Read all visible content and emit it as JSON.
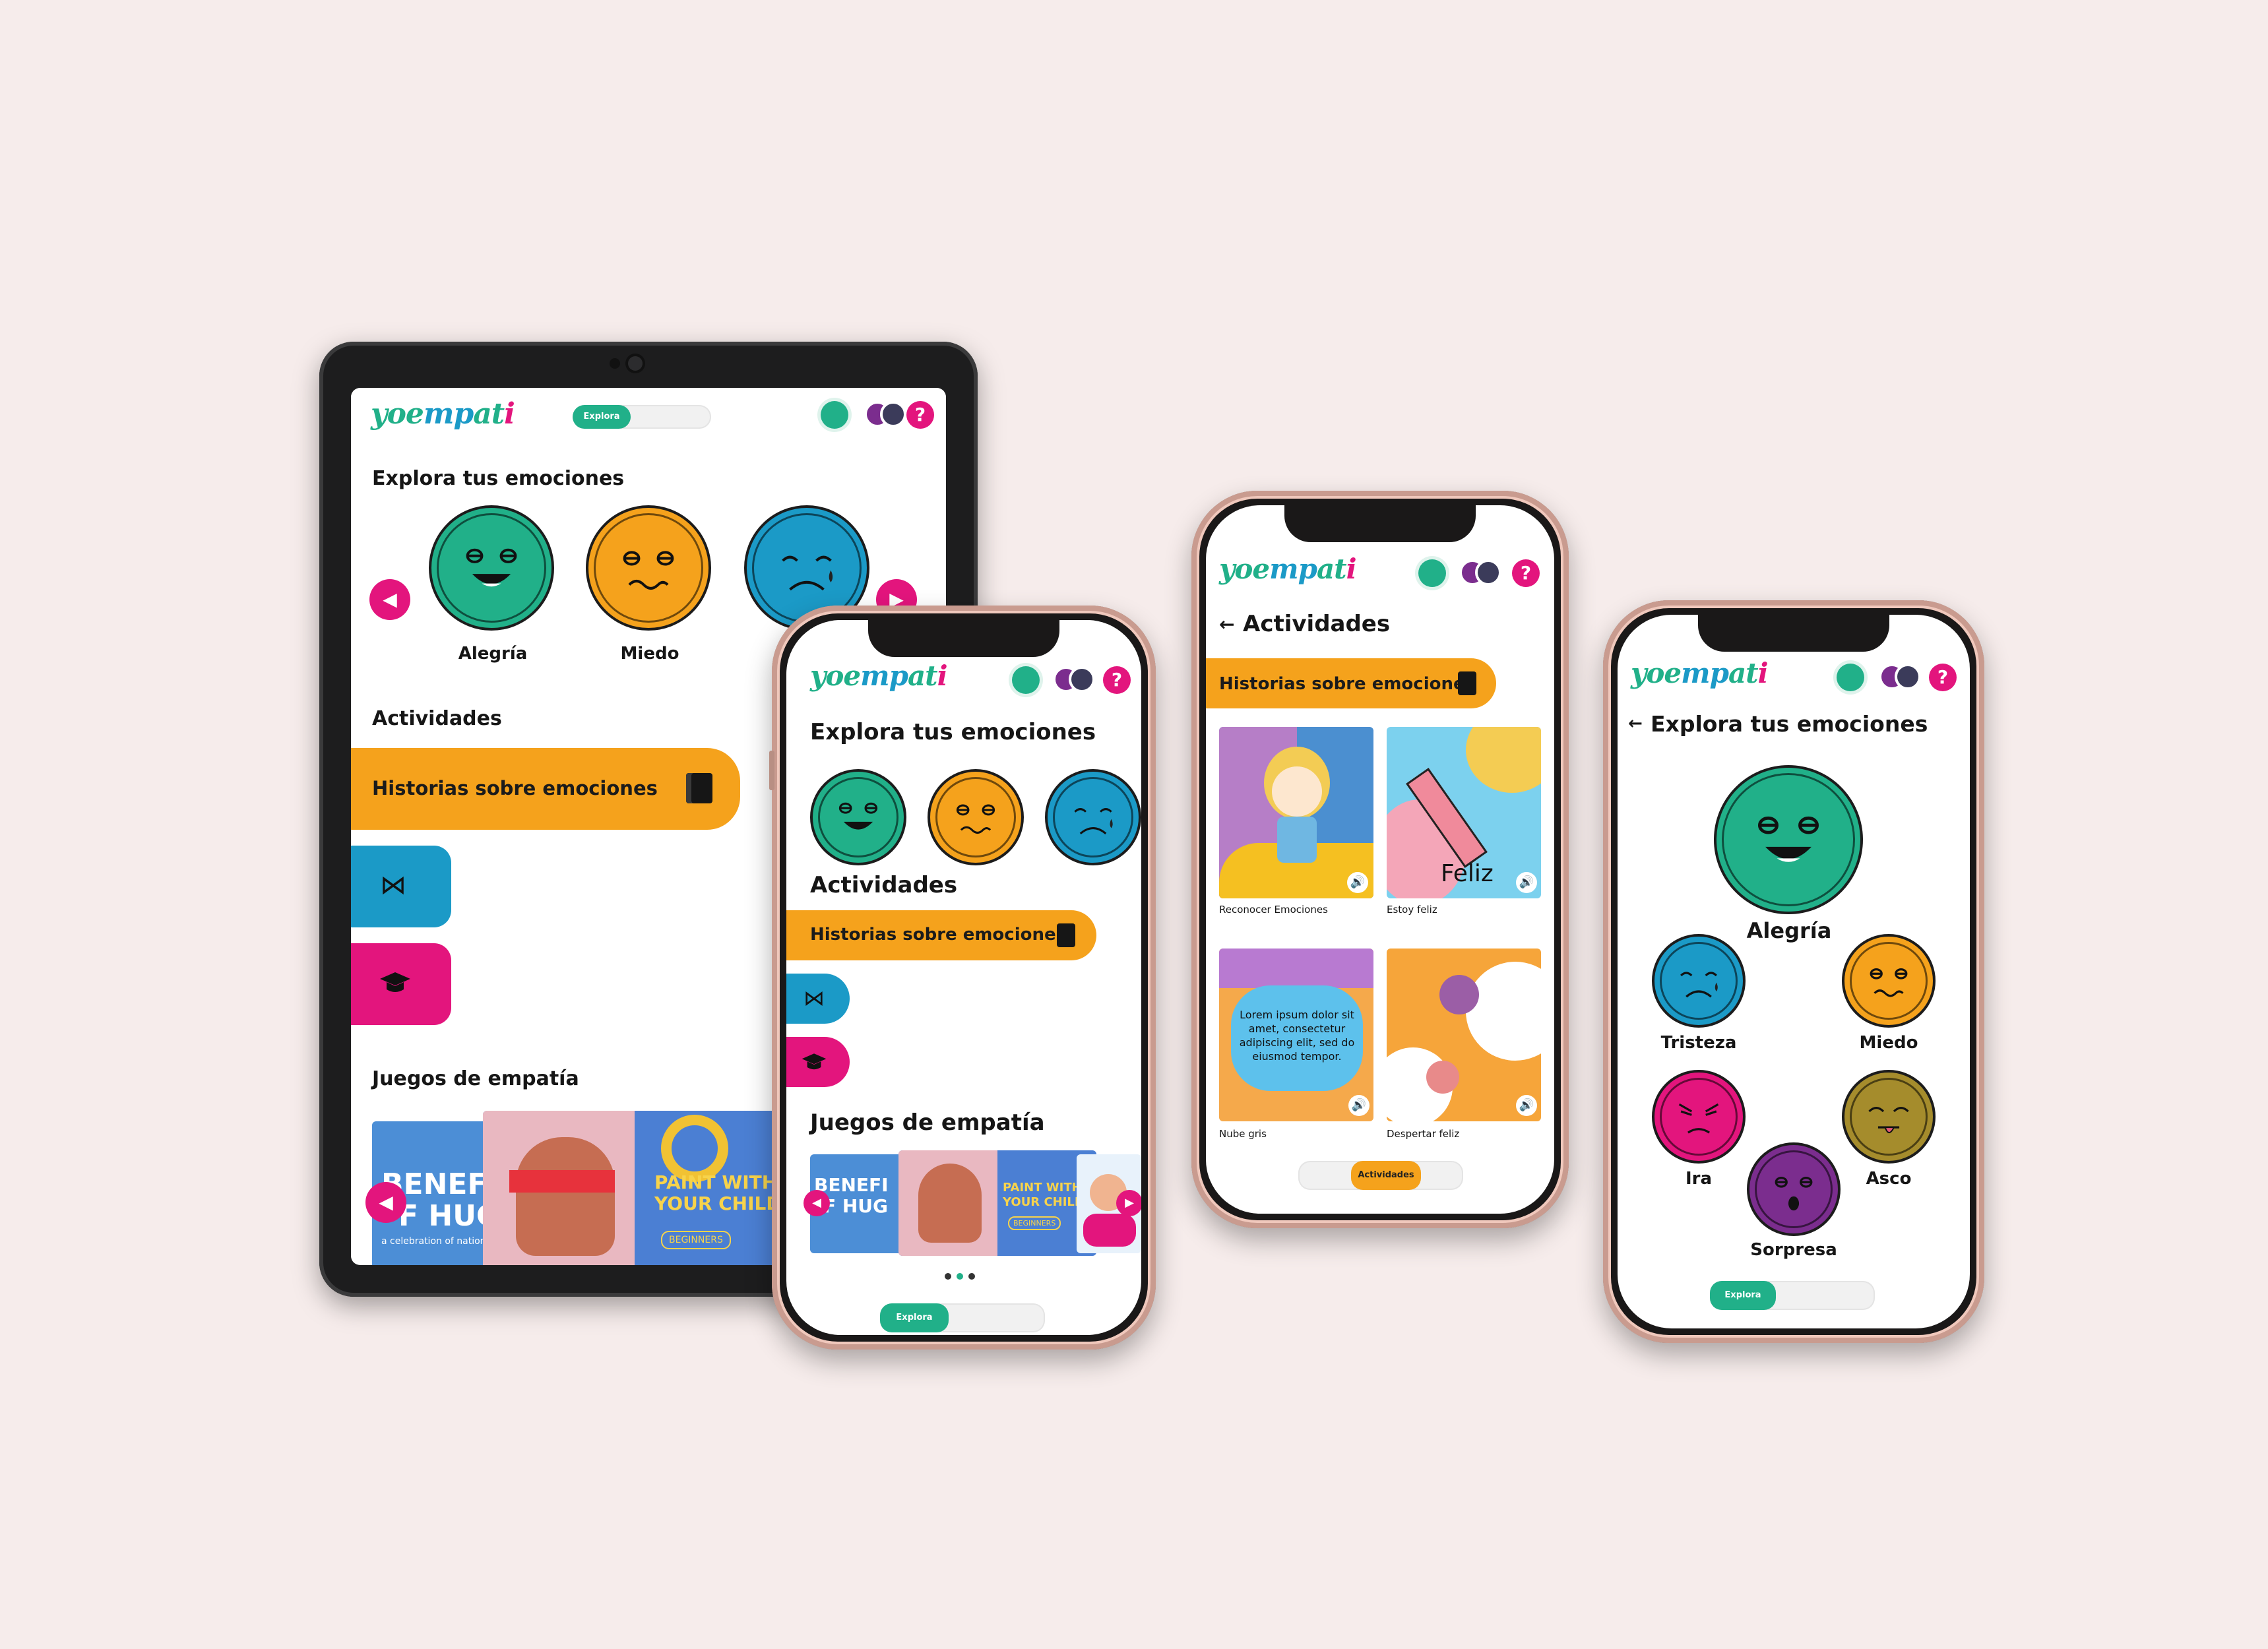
{
  "colors": {
    "background": "#f6eceb",
    "teal": "#21b089",
    "orange": "#f5a21c",
    "blue": "#1b9ac7",
    "pink": "#e3157d",
    "olive": "#a58c2c",
    "purple": "#7b2d8e"
  },
  "app": {
    "logo": "yoempati",
    "nav_explora": "Explora",
    "nav_actividades": "Actividades",
    "help_symbol": "?"
  },
  "tablet": {
    "section_emotions": "Explora tus emociones",
    "emotions": [
      {
        "label": "Alegría",
        "color": "#21b089"
      },
      {
        "label": "Miedo",
        "color": "#f5a21c"
      },
      {
        "label": "",
        "color": "#1b9ac7"
      }
    ],
    "section_activities": "Actividades",
    "activity_main": "Historias sobre emociones",
    "section_games": "Juegos de empatía",
    "game_cards": [
      {
        "text": "BENEFI",
        "text2": "F HUG",
        "sub": "a celebration of national"
      },
      {
        "text": "PAINT WITH",
        "text2": "YOUR CHILD",
        "sub": "BEGINNERS"
      }
    ]
  },
  "phone1": {
    "section_emotions": "Explora tus emociones",
    "section_activities": "Actividades",
    "activity_main": "Historias sobre emociones",
    "section_games": "Juegos de empatía",
    "game_cards": [
      {
        "text": "BENEFI",
        "text2": "F HUG"
      },
      {
        "text": "PAINT WITH",
        "text2": "YOUR CHILD",
        "sub": "BEGINNERS"
      }
    ]
  },
  "phone2": {
    "back_title": "Actividades",
    "category": "Historias sobre emociones",
    "cards": [
      {
        "caption": "Reconocer Emociones",
        "overlay": ""
      },
      {
        "caption": "Estoy feliz",
        "overlay": "Feliz"
      },
      {
        "caption": "Nube gris",
        "overlay": "Lorem ipsum dolor sit amet, consectetur adipiscing elit, sed do eiusmod tempor."
      },
      {
        "caption": "Despertar feliz",
        "overlay": ""
      }
    ]
  },
  "phone3": {
    "back_title": "Explora tus emociones",
    "emotions": [
      {
        "label": "Alegría",
        "color": "#21b089"
      },
      {
        "label": "Tristeza",
        "color": "#1b9ac7"
      },
      {
        "label": "Miedo",
        "color": "#f5a21c"
      },
      {
        "label": "Ira",
        "color": "#e3157d"
      },
      {
        "label": "Asco",
        "color": "#a58c2c"
      },
      {
        "label": "Sorpresa",
        "color": "#7b2d8e"
      }
    ]
  }
}
